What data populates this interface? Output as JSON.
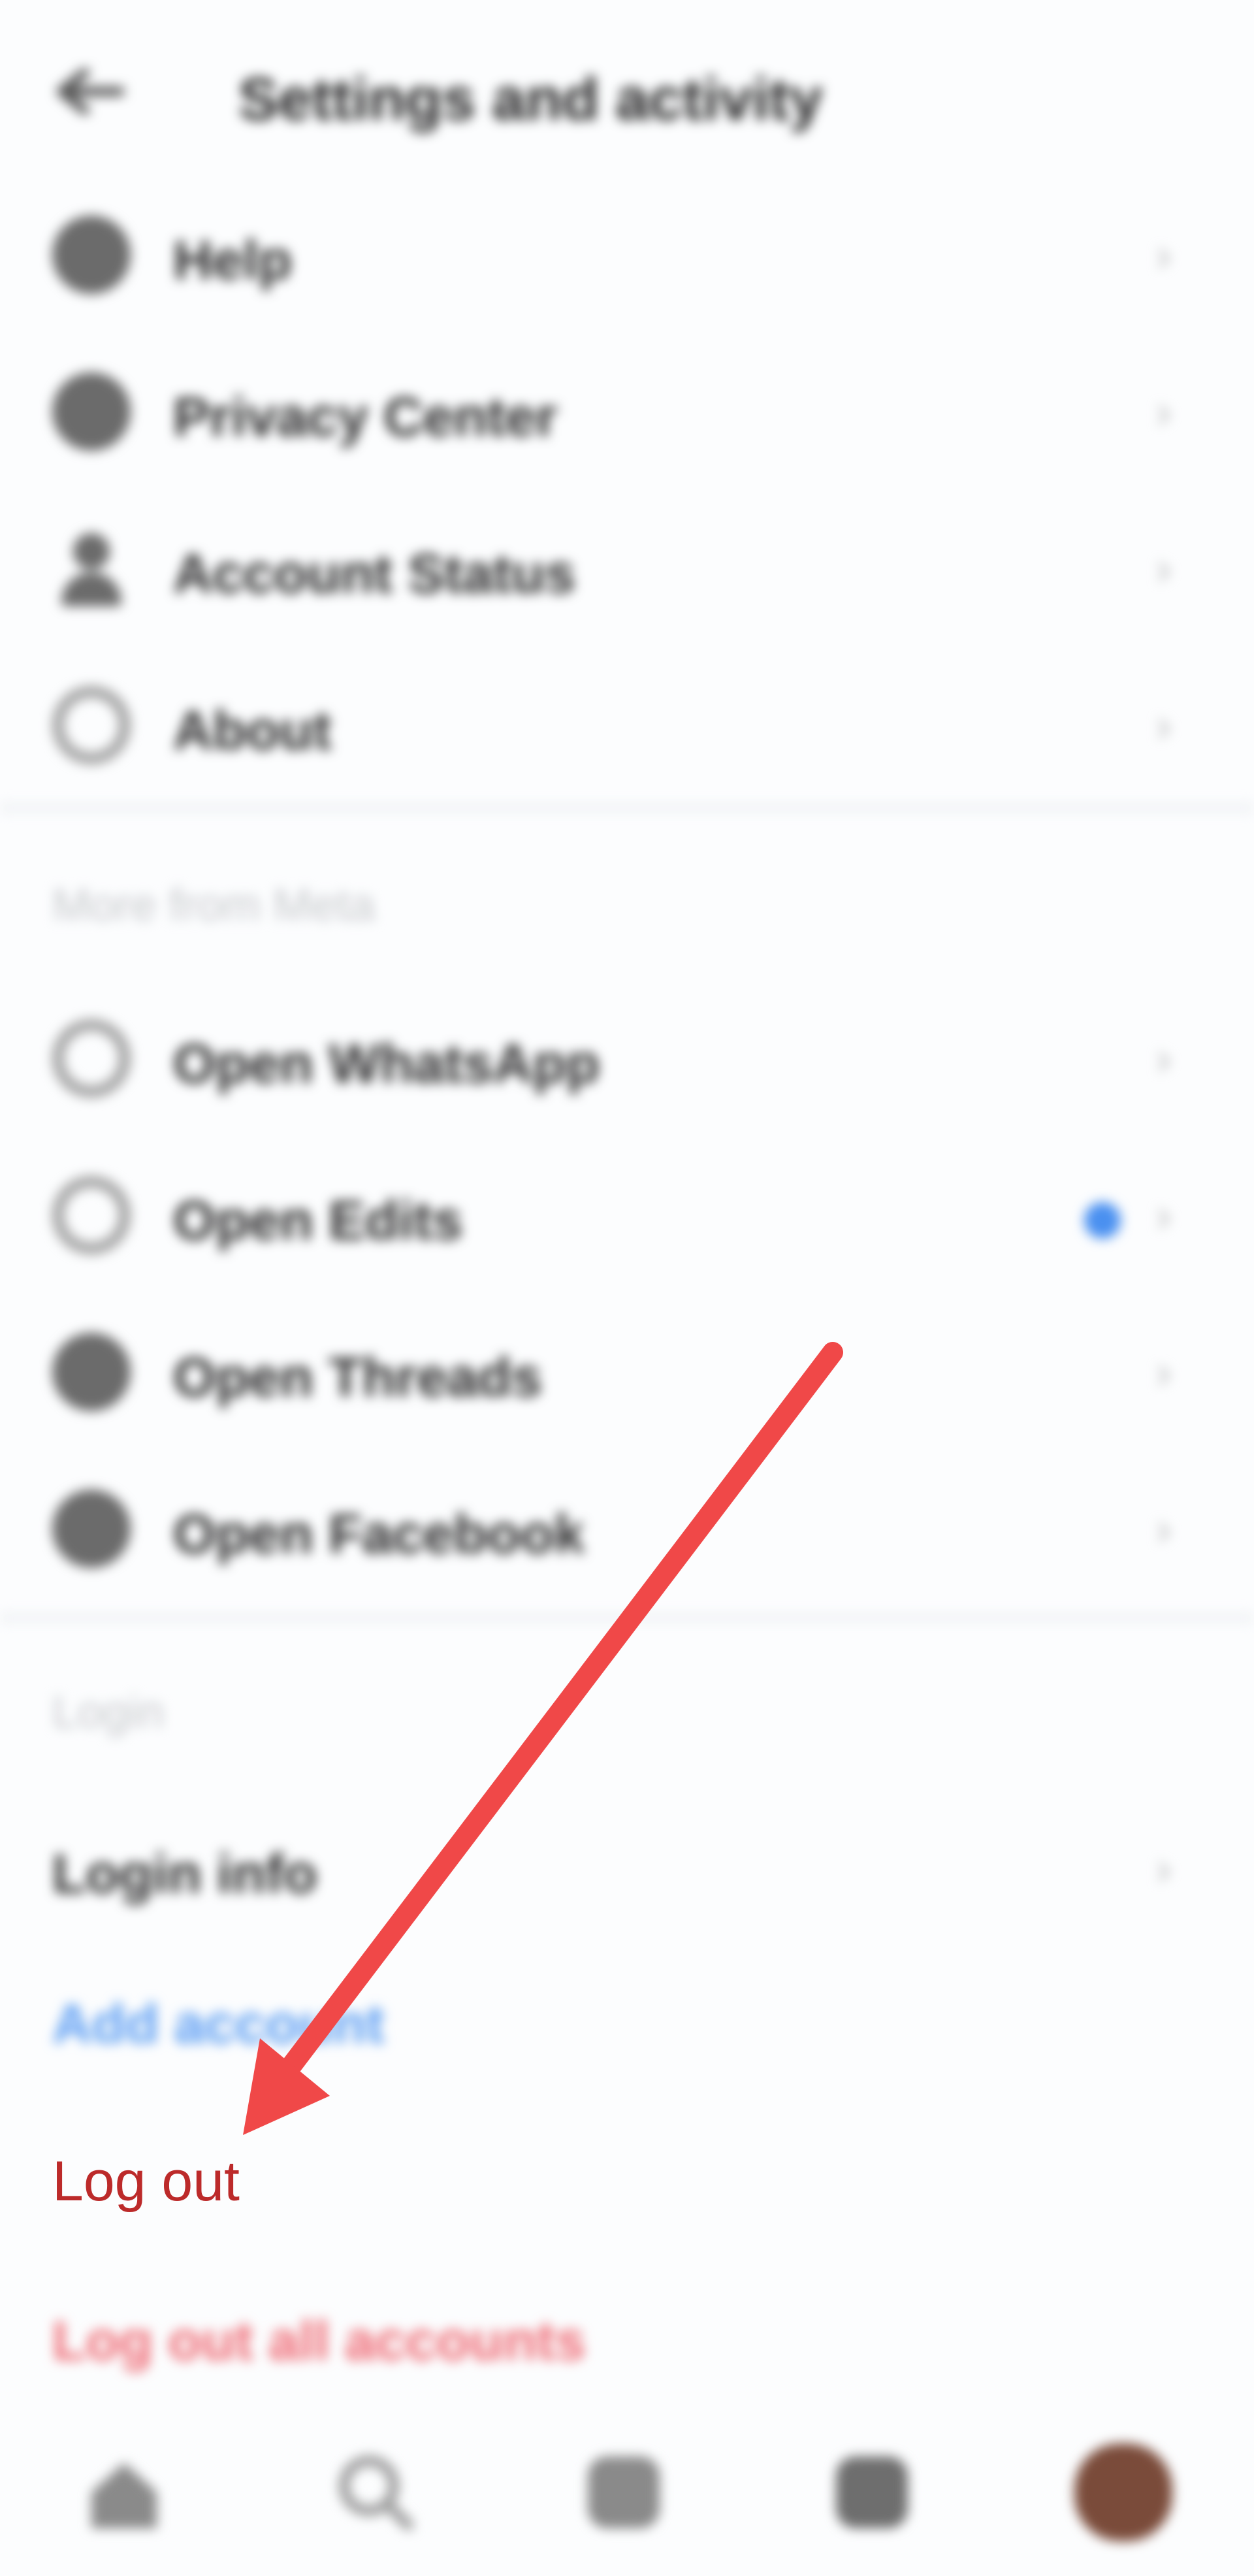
{
  "header": {
    "title": "Settings and activity",
    "back_icon": "arrow-left-icon"
  },
  "rows_group_1": [
    {
      "label": "Help",
      "icon": "lifebuoy-icon"
    },
    {
      "label": "Privacy Center",
      "icon": "shield-icon"
    },
    {
      "label": "Account Status",
      "icon": "person-icon"
    },
    {
      "label": "About",
      "icon": "info-icon"
    }
  ],
  "section_more": {
    "label": "More from Meta"
  },
  "rows_group_2": [
    {
      "label": "Open WhatsApp",
      "icon": "whatsapp-icon"
    },
    {
      "label": "Open Edits",
      "icon": "edits-icon"
    },
    {
      "label": "Open Threads",
      "icon": "threads-icon"
    },
    {
      "label": "Open Facebook",
      "icon": "facebook-icon"
    }
  ],
  "section_login": {
    "label": "Login",
    "login_info": "Login info",
    "add_account": "Add account",
    "log_out": "Log out",
    "log_out_all": "Log out all accounts"
  },
  "colors": {
    "logout_red": "#bc2a2a",
    "arrow_red": "#f04848",
    "link_blue": "#5b9df2"
  },
  "bottom_nav": [
    "home-icon",
    "search-icon",
    "reels-icon",
    "shop-icon",
    "profile-avatar"
  ]
}
